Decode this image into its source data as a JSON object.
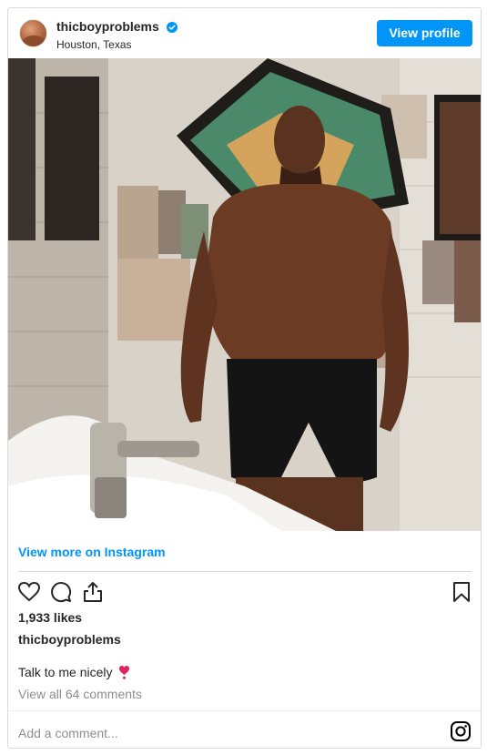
{
  "header": {
    "username": "thicboyproblems",
    "verified_icon": "verified-badge-icon",
    "location": "Houston, Texas",
    "view_profile_label": "View profile"
  },
  "post": {
    "view_more_label": "View more on Instagram",
    "likes": "1,933 likes",
    "caption_user": "thicboyproblems",
    "caption_text": "Talk to me nicely",
    "caption_emoji": "heart-exclamation-icon",
    "comments_link": "View all 64 comments",
    "add_comment_placeholder": "Add a comment...",
    "icons": [
      "heart-icon",
      "comment-icon",
      "share-icon",
      "bookmark-icon",
      "instagram-icon"
    ]
  },
  "colors": {
    "accent": "#0095f6",
    "text": "#262626",
    "muted": "#8e8e8e",
    "border": "#dbdbdb"
  }
}
